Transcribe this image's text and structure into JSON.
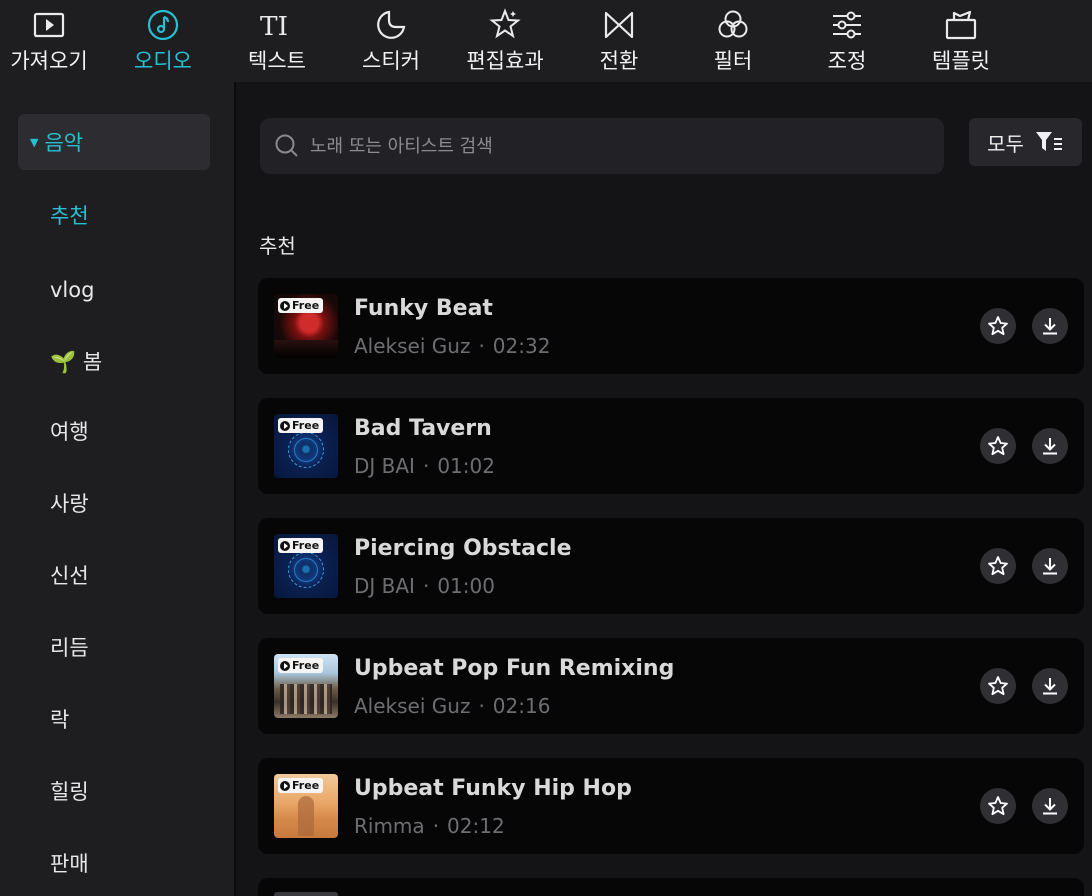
{
  "toolbar": {
    "tabs": [
      {
        "label": "가져오기",
        "icon": "media-import-icon"
      },
      {
        "label": "오디오",
        "icon": "music-note-icon",
        "active": true
      },
      {
        "label": "텍스트",
        "icon": "text-icon"
      },
      {
        "label": "스티커",
        "icon": "sticker-icon"
      },
      {
        "label": "편집효과",
        "icon": "effects-star-icon"
      },
      {
        "label": "전환",
        "icon": "transition-icon"
      },
      {
        "label": "필터",
        "icon": "filter-circles-icon"
      },
      {
        "label": "조정",
        "icon": "adjust-sliders-icon"
      },
      {
        "label": "템플릿",
        "icon": "template-icon"
      }
    ]
  },
  "sidebar": {
    "category": "음악",
    "items": [
      {
        "label": "추천",
        "active": true
      },
      {
        "label": "vlog"
      },
      {
        "label": "🌱 봄"
      },
      {
        "label": "여행"
      },
      {
        "label": "사랑"
      },
      {
        "label": "신선"
      },
      {
        "label": "리듬"
      },
      {
        "label": "락"
      },
      {
        "label": "힐링"
      },
      {
        "label": "판매"
      }
    ]
  },
  "search": {
    "placeholder": "노래 또는 아티스트 검색"
  },
  "filter": {
    "label": "모두"
  },
  "section": {
    "title": "추천"
  },
  "tracks": [
    {
      "title": "Funky Beat",
      "artist": "Aleksei Guz",
      "duration": "02:32",
      "badge": "Free"
    },
    {
      "title": "Bad Tavern",
      "artist": "DJ BAI",
      "duration": "01:02",
      "badge": "Free"
    },
    {
      "title": "Piercing Obstacle",
      "artist": "DJ BAI",
      "duration": "01:00",
      "badge": "Free"
    },
    {
      "title": "Upbeat Pop Fun Remixing",
      "artist": "Aleksei Guz",
      "duration": "02:16",
      "badge": "Free"
    },
    {
      "title": "Upbeat Funky Hip Hop",
      "artist": "Rimma",
      "duration": "02:12",
      "badge": "Free"
    }
  ],
  "meta_separator": "·",
  "colors": {
    "accent": "#27c0d3",
    "panel": "#1e1e21",
    "background": "#141417",
    "card": "#060607"
  }
}
